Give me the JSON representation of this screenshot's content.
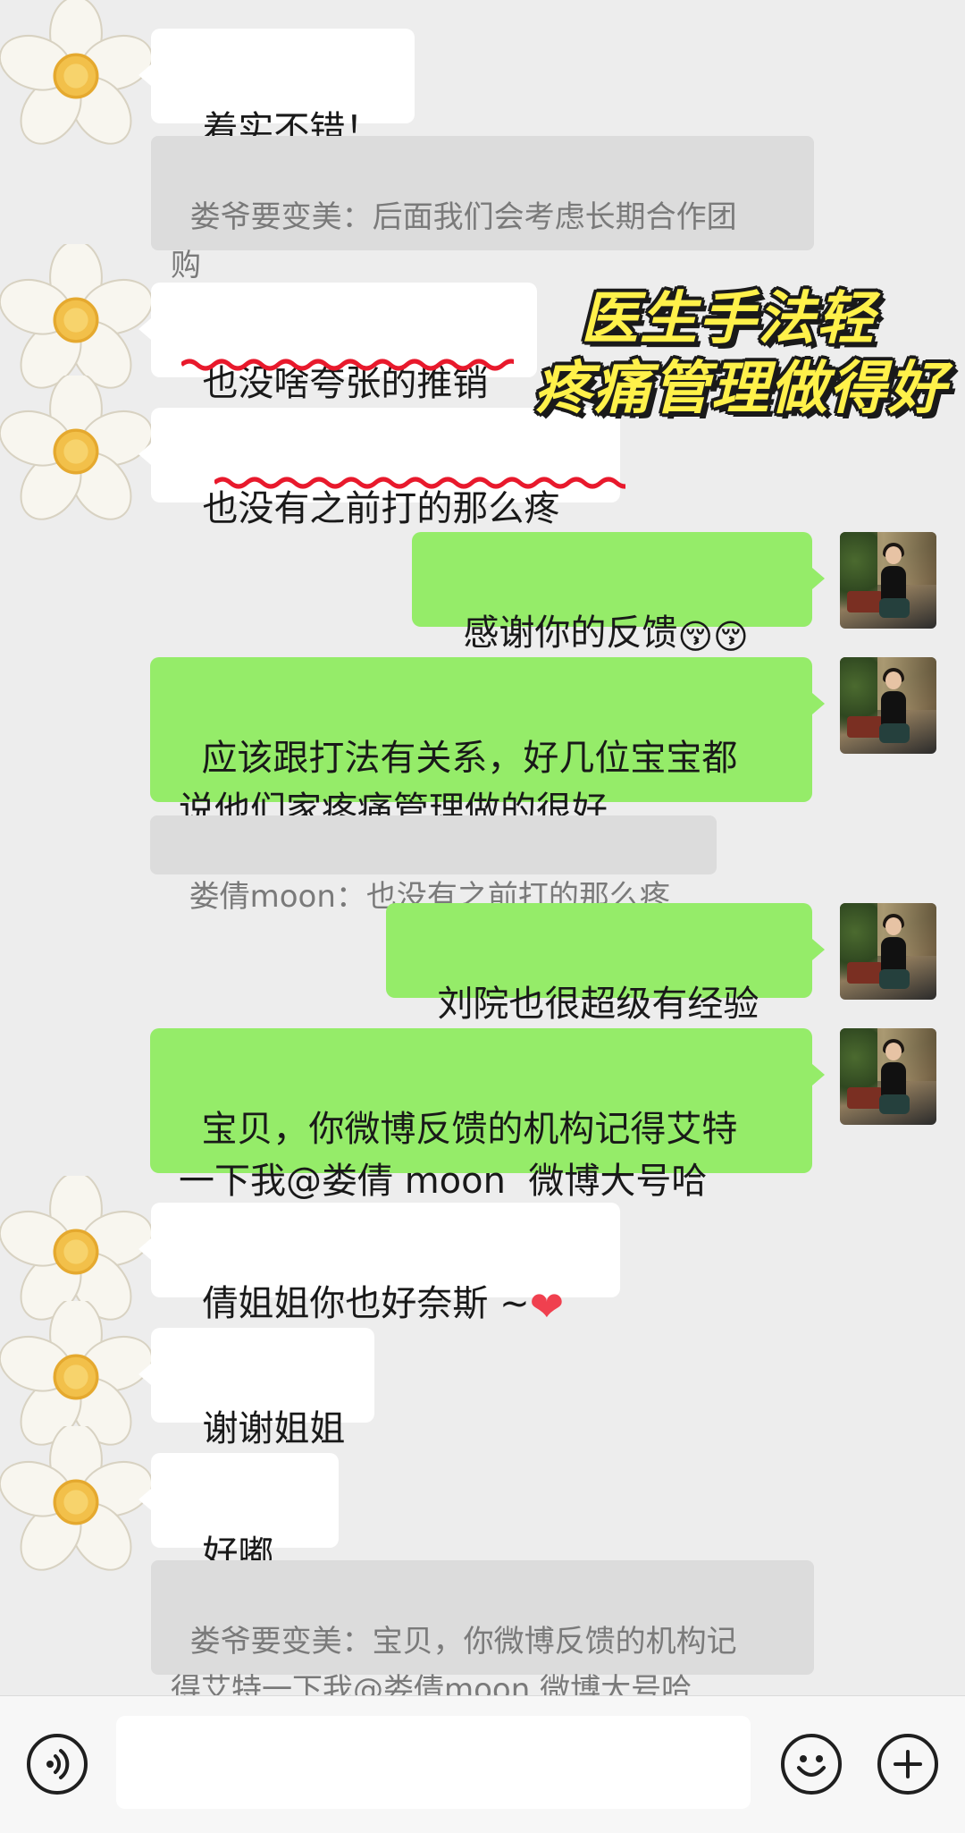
{
  "messages": [
    {
      "id": "m1",
      "text": "着实不错！"
    },
    {
      "id": "q1",
      "text": "娄爷要变美：后面我们会考虑长期合作团\n购"
    },
    {
      "id": "m2",
      "text": "也没啥夸张的推销"
    },
    {
      "id": "m3",
      "text": "也没有之前打的那么疼"
    },
    {
      "id": "m4",
      "text": "感谢你的反馈"
    },
    {
      "id": "m5",
      "text": "应该跟打法有关系，好几位宝宝都\n说他们家疼痛管理做的很好"
    },
    {
      "id": "q2",
      "text": "娄倩moon：也没有之前打的那么疼"
    },
    {
      "id": "m6",
      "text": "刘院也很超级有经验"
    },
    {
      "id": "m7",
      "text": "宝贝，你微博反馈的机构记得艾特\n一下我@娄倩 moon  微博大号哈"
    },
    {
      "id": "m8",
      "text": "倩姐姐你也好奈斯 ~"
    },
    {
      "id": "m9",
      "text": "谢谢姐姐"
    },
    {
      "id": "m10",
      "text": "好嘟"
    },
    {
      "id": "q3",
      "text": "娄爷要变美：宝贝，你微博反馈的机构记\n得艾特一下我@娄倩moon 微博大号哈"
    }
  ],
  "caption": {
    "line1": "医生手法轻",
    "line2": "疼痛管理做得好"
  },
  "emoji": {
    "kiss": "😚",
    "heart": "❤",
    "hug": "🤗"
  },
  "colors": {
    "background": "#ededed",
    "incoming_bubble": "#ffffff",
    "outgoing_bubble": "#95ec69",
    "quote_bg": "#dcdcdc",
    "underline": "#e8192c",
    "caption_text": "#fff14a"
  },
  "icons": {
    "voice": "voice-icon",
    "emoji": "emoji-icon",
    "plus": "plus-icon"
  }
}
